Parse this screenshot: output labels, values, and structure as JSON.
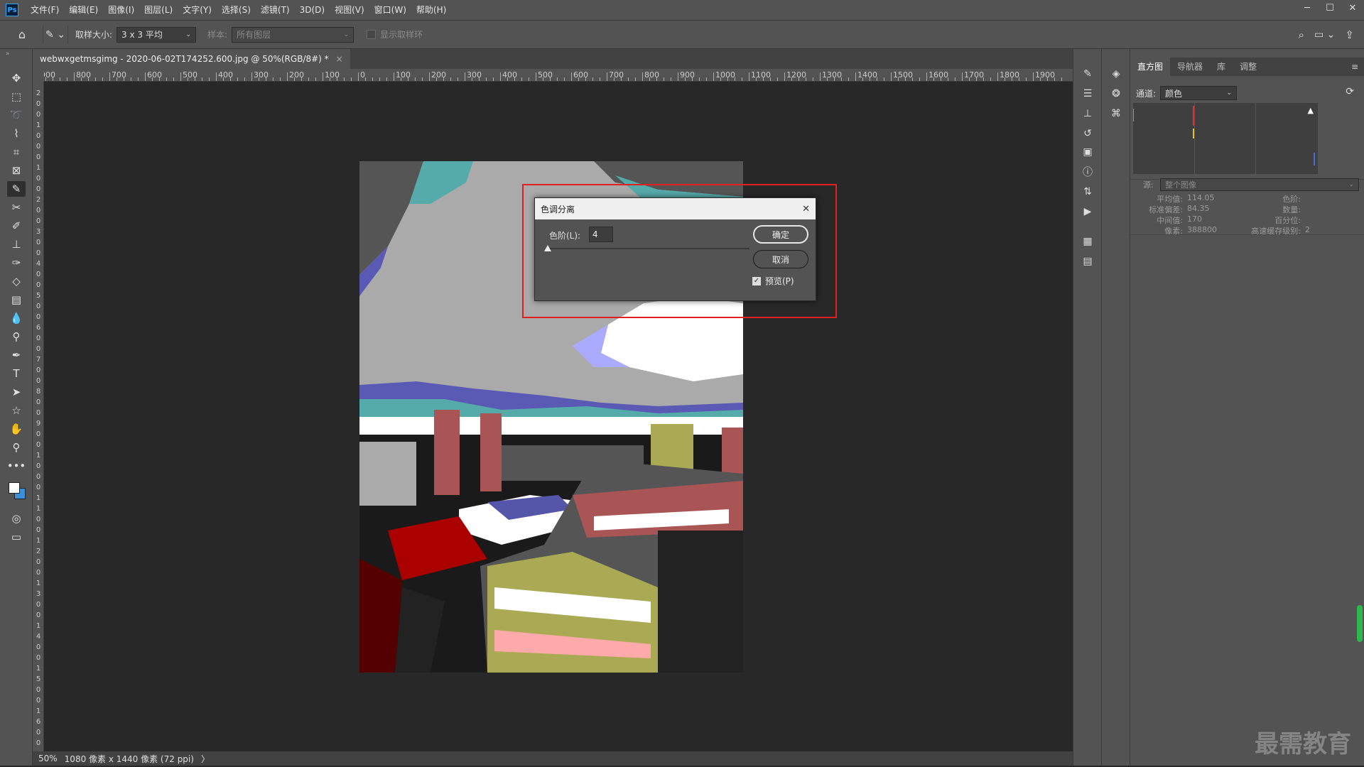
{
  "menu": {
    "logo": "Ps",
    "items": [
      "文件(F)",
      "编辑(E)",
      "图像(I)",
      "图层(L)",
      "文字(Y)",
      "选择(S)",
      "滤镜(T)",
      "3D(D)",
      "视图(V)",
      "窗口(W)",
      "帮助(H)"
    ]
  },
  "options": {
    "sample_size_label": "取样大小:",
    "sample_size_value": "3 x 3 平均",
    "sample_label": "样本:",
    "sample_value": "所有图层",
    "show_ring_label": "显示取样环"
  },
  "document": {
    "tab_title": "webwxgetmsgimg - 2020-06-02T174252.600.jpg @ 50%(RGB/8#) *",
    "tab_close": "×"
  },
  "ruler_h": [
    "900",
    "800",
    "700",
    "600",
    "500",
    "400",
    "300",
    "200",
    "100",
    "0",
    "100",
    "200",
    "300",
    "400",
    "500",
    "600",
    "700",
    "800",
    "900",
    "1000",
    "1100",
    "1200",
    "1300",
    "1400",
    "1500",
    "1600",
    "1700",
    "1800",
    "1900"
  ],
  "ruler_v": [
    "2",
    "0",
    "0",
    "1",
    "0",
    "0",
    "0",
    "1",
    "0",
    "0",
    "2",
    "0",
    "0",
    "3",
    "0",
    "0",
    "4",
    "0",
    "0",
    "5",
    "0",
    "0",
    "6",
    "0",
    "0",
    "7",
    "0",
    "0",
    "8",
    "0",
    "0",
    "9",
    "0",
    "0",
    "1",
    "0",
    "0",
    "0",
    "1",
    "1",
    "0",
    "0",
    "1",
    "2",
    "0",
    "0",
    "1",
    "3",
    "0",
    "0",
    "1",
    "4",
    "0",
    "0",
    "1",
    "5",
    "0",
    "0",
    "1",
    "6",
    "0",
    "0"
  ],
  "status": {
    "zoom": "50%",
    "info": "1080 像素 x 1440 像素 (72 ppi)",
    "arrow": "〉"
  },
  "panel": {
    "tabs": [
      "直方图",
      "导航器",
      "库",
      "调整"
    ],
    "channel_label": "通道:",
    "channel_value": "颜色",
    "source_label": "源:",
    "source_value": "整个图像",
    "stats_left": [
      {
        "label": "平均值:",
        "value": "114.05"
      },
      {
        "label": "标准偏差:",
        "value": "84.35"
      },
      {
        "label": "中间值:",
        "value": "170"
      },
      {
        "label": "像素:",
        "value": "388800"
      }
    ],
    "stats_right": [
      {
        "label": "色阶:",
        "value": ""
      },
      {
        "label": "数量:",
        "value": ""
      },
      {
        "label": "百分位:",
        "value": ""
      },
      {
        "label": "高速缓存级别:",
        "value": "2"
      }
    ]
  },
  "dialog": {
    "title": "色调分离",
    "close": "✕",
    "levels_label": "色阶(L):",
    "levels_value": "4",
    "ok_label": "确定",
    "cancel_label": "取消",
    "preview_label": "预览(P)",
    "preview_checked": true,
    "slider_fraction": 0.0
  },
  "watermark": "最需教育",
  "colors": {
    "accent_red": "#e0211d",
    "ps_blue": "#31a8ff",
    "ui_gray": "#535353"
  }
}
